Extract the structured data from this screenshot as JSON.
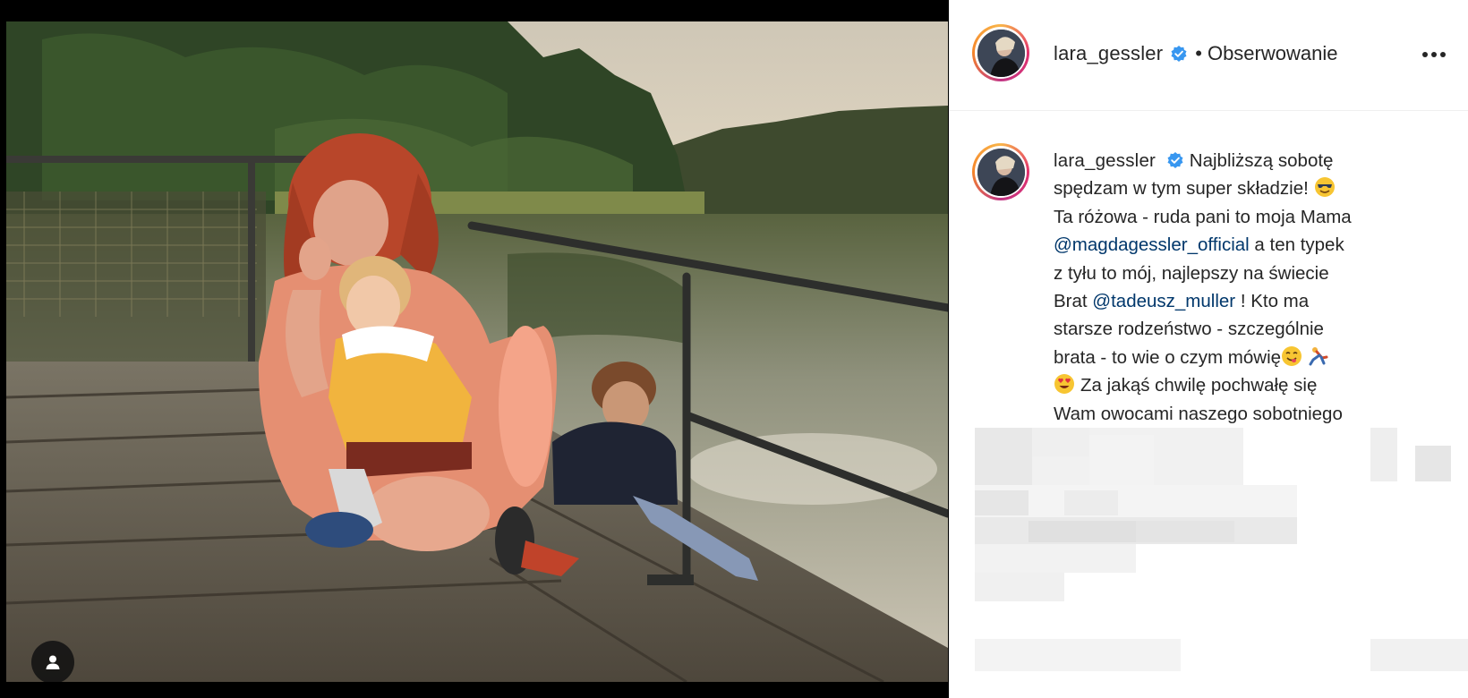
{
  "post": {
    "username": "lara_gessler",
    "separator": "•",
    "follow_status": "Obserwowanie",
    "more_icon": "more-horizontal-icon",
    "verified_color": "#3897f0"
  },
  "caption": {
    "username": "lara_gessler",
    "line1": "Najbliższą sobotę",
    "line2": "spędzam w tym super składzie!",
    "line3": "Ta różowa - ruda pani to moja Mama",
    "mention1": "@magdagessler_official",
    "line4_rest": " a ten typek",
    "line5": "z tyłu to mój, najlepszy na świecie",
    "line6_start": "Brat ",
    "mention2": "@tadeusz_muller",
    "line6_rest": " ! Kto ma",
    "line7": "starsze rodzeństwo - szczególnie",
    "line8": "brata - to wie o czym mówię",
    "line9": "Za jakąś chwilę pochwałę się",
    "line10": "Wam owocami naszego sobotniego",
    "mention_color": "#00376b"
  },
  "photo": {
    "tag_icon": "user-tag-icon"
  }
}
